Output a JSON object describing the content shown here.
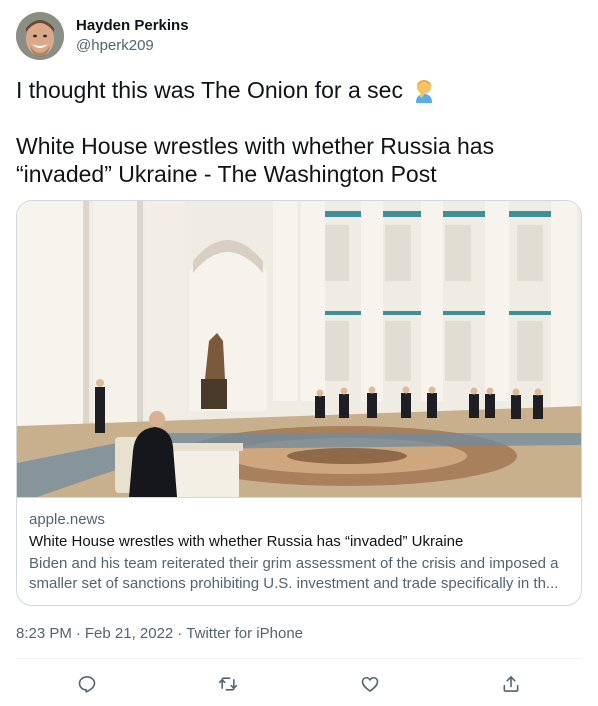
{
  "author": {
    "display_name": "Hayden Perkins",
    "handle": "@hperk209",
    "avatar_icon": "avatar-photo"
  },
  "tweet": {
    "line1": "I thought this was The Onion for a sec",
    "emoji_icon": "person-facepalming-emoji",
    "line2": "White House wrestles with whether Russia has “invaded” Ukraine - The Washington Post"
  },
  "card": {
    "image_icon": "article-photo-kremlin-hall",
    "domain": "apple.news",
    "title": "White House wrestles with whether Russia has “invaded” Ukraine",
    "description": "Biden and his team reiterated their grim assessment of the crisis and imposed a smaller set of sanctions prohibiting U.S. investment and trade specifically in th..."
  },
  "meta": {
    "time": "8:23 PM",
    "separator": "·",
    "date": "Feb 21, 2022",
    "source": "Twitter for iPhone"
  },
  "actions": {
    "icons": [
      "reply-icon",
      "retweet-icon",
      "like-icon",
      "share-icon"
    ],
    "icon_color": "#536471"
  },
  "colors": {
    "text_primary": "#0f1419",
    "text_secondary": "#536471",
    "border": "#cfd9de"
  }
}
